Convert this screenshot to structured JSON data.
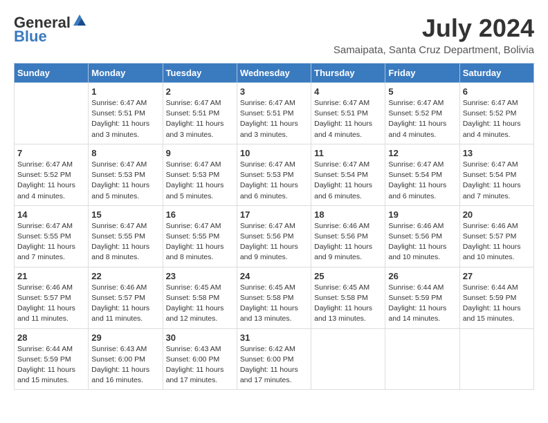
{
  "logo": {
    "general": "General",
    "blue": "Blue"
  },
  "title": {
    "month": "July 2024",
    "location": "Samaipata, Santa Cruz Department, Bolivia"
  },
  "weekdays": [
    "Sunday",
    "Monday",
    "Tuesday",
    "Wednesday",
    "Thursday",
    "Friday",
    "Saturday"
  ],
  "weeks": [
    [
      {
        "day": "",
        "sunrise": "",
        "sunset": "",
        "daylight": ""
      },
      {
        "day": "1",
        "sunrise": "Sunrise: 6:47 AM",
        "sunset": "Sunset: 5:51 PM",
        "daylight": "Daylight: 11 hours and 3 minutes."
      },
      {
        "day": "2",
        "sunrise": "Sunrise: 6:47 AM",
        "sunset": "Sunset: 5:51 PM",
        "daylight": "Daylight: 11 hours and 3 minutes."
      },
      {
        "day": "3",
        "sunrise": "Sunrise: 6:47 AM",
        "sunset": "Sunset: 5:51 PM",
        "daylight": "Daylight: 11 hours and 3 minutes."
      },
      {
        "day": "4",
        "sunrise": "Sunrise: 6:47 AM",
        "sunset": "Sunset: 5:51 PM",
        "daylight": "Daylight: 11 hours and 4 minutes."
      },
      {
        "day": "5",
        "sunrise": "Sunrise: 6:47 AM",
        "sunset": "Sunset: 5:52 PM",
        "daylight": "Daylight: 11 hours and 4 minutes."
      },
      {
        "day": "6",
        "sunrise": "Sunrise: 6:47 AM",
        "sunset": "Sunset: 5:52 PM",
        "daylight": "Daylight: 11 hours and 4 minutes."
      }
    ],
    [
      {
        "day": "7",
        "sunrise": "Sunrise: 6:47 AM",
        "sunset": "Sunset: 5:52 PM",
        "daylight": "Daylight: 11 hours and 4 minutes."
      },
      {
        "day": "8",
        "sunrise": "Sunrise: 6:47 AM",
        "sunset": "Sunset: 5:53 PM",
        "daylight": "Daylight: 11 hours and 5 minutes."
      },
      {
        "day": "9",
        "sunrise": "Sunrise: 6:47 AM",
        "sunset": "Sunset: 5:53 PM",
        "daylight": "Daylight: 11 hours and 5 minutes."
      },
      {
        "day": "10",
        "sunrise": "Sunrise: 6:47 AM",
        "sunset": "Sunset: 5:53 PM",
        "daylight": "Daylight: 11 hours and 6 minutes."
      },
      {
        "day": "11",
        "sunrise": "Sunrise: 6:47 AM",
        "sunset": "Sunset: 5:54 PM",
        "daylight": "Daylight: 11 hours and 6 minutes."
      },
      {
        "day": "12",
        "sunrise": "Sunrise: 6:47 AM",
        "sunset": "Sunset: 5:54 PM",
        "daylight": "Daylight: 11 hours and 6 minutes."
      },
      {
        "day": "13",
        "sunrise": "Sunrise: 6:47 AM",
        "sunset": "Sunset: 5:54 PM",
        "daylight": "Daylight: 11 hours and 7 minutes."
      }
    ],
    [
      {
        "day": "14",
        "sunrise": "Sunrise: 6:47 AM",
        "sunset": "Sunset: 5:55 PM",
        "daylight": "Daylight: 11 hours and 7 minutes."
      },
      {
        "day": "15",
        "sunrise": "Sunrise: 6:47 AM",
        "sunset": "Sunset: 5:55 PM",
        "daylight": "Daylight: 11 hours and 8 minutes."
      },
      {
        "day": "16",
        "sunrise": "Sunrise: 6:47 AM",
        "sunset": "Sunset: 5:55 PM",
        "daylight": "Daylight: 11 hours and 8 minutes."
      },
      {
        "day": "17",
        "sunrise": "Sunrise: 6:47 AM",
        "sunset": "Sunset: 5:56 PM",
        "daylight": "Daylight: 11 hours and 9 minutes."
      },
      {
        "day": "18",
        "sunrise": "Sunrise: 6:46 AM",
        "sunset": "Sunset: 5:56 PM",
        "daylight": "Daylight: 11 hours and 9 minutes."
      },
      {
        "day": "19",
        "sunrise": "Sunrise: 6:46 AM",
        "sunset": "Sunset: 5:56 PM",
        "daylight": "Daylight: 11 hours and 10 minutes."
      },
      {
        "day": "20",
        "sunrise": "Sunrise: 6:46 AM",
        "sunset": "Sunset: 5:57 PM",
        "daylight": "Daylight: 11 hours and 10 minutes."
      }
    ],
    [
      {
        "day": "21",
        "sunrise": "Sunrise: 6:46 AM",
        "sunset": "Sunset: 5:57 PM",
        "daylight": "Daylight: 11 hours and 11 minutes."
      },
      {
        "day": "22",
        "sunrise": "Sunrise: 6:46 AM",
        "sunset": "Sunset: 5:57 PM",
        "daylight": "Daylight: 11 hours and 11 minutes."
      },
      {
        "day": "23",
        "sunrise": "Sunrise: 6:45 AM",
        "sunset": "Sunset: 5:58 PM",
        "daylight": "Daylight: 11 hours and 12 minutes."
      },
      {
        "day": "24",
        "sunrise": "Sunrise: 6:45 AM",
        "sunset": "Sunset: 5:58 PM",
        "daylight": "Daylight: 11 hours and 13 minutes."
      },
      {
        "day": "25",
        "sunrise": "Sunrise: 6:45 AM",
        "sunset": "Sunset: 5:58 PM",
        "daylight": "Daylight: 11 hours and 13 minutes."
      },
      {
        "day": "26",
        "sunrise": "Sunrise: 6:44 AM",
        "sunset": "Sunset: 5:59 PM",
        "daylight": "Daylight: 11 hours and 14 minutes."
      },
      {
        "day": "27",
        "sunrise": "Sunrise: 6:44 AM",
        "sunset": "Sunset: 5:59 PM",
        "daylight": "Daylight: 11 hours and 15 minutes."
      }
    ],
    [
      {
        "day": "28",
        "sunrise": "Sunrise: 6:44 AM",
        "sunset": "Sunset: 5:59 PM",
        "daylight": "Daylight: 11 hours and 15 minutes."
      },
      {
        "day": "29",
        "sunrise": "Sunrise: 6:43 AM",
        "sunset": "Sunset: 6:00 PM",
        "daylight": "Daylight: 11 hours and 16 minutes."
      },
      {
        "day": "30",
        "sunrise": "Sunrise: 6:43 AM",
        "sunset": "Sunset: 6:00 PM",
        "daylight": "Daylight: 11 hours and 17 minutes."
      },
      {
        "day": "31",
        "sunrise": "Sunrise: 6:42 AM",
        "sunset": "Sunset: 6:00 PM",
        "daylight": "Daylight: 11 hours and 17 minutes."
      },
      {
        "day": "",
        "sunrise": "",
        "sunset": "",
        "daylight": ""
      },
      {
        "day": "",
        "sunrise": "",
        "sunset": "",
        "daylight": ""
      },
      {
        "day": "",
        "sunrise": "",
        "sunset": "",
        "daylight": ""
      }
    ]
  ]
}
